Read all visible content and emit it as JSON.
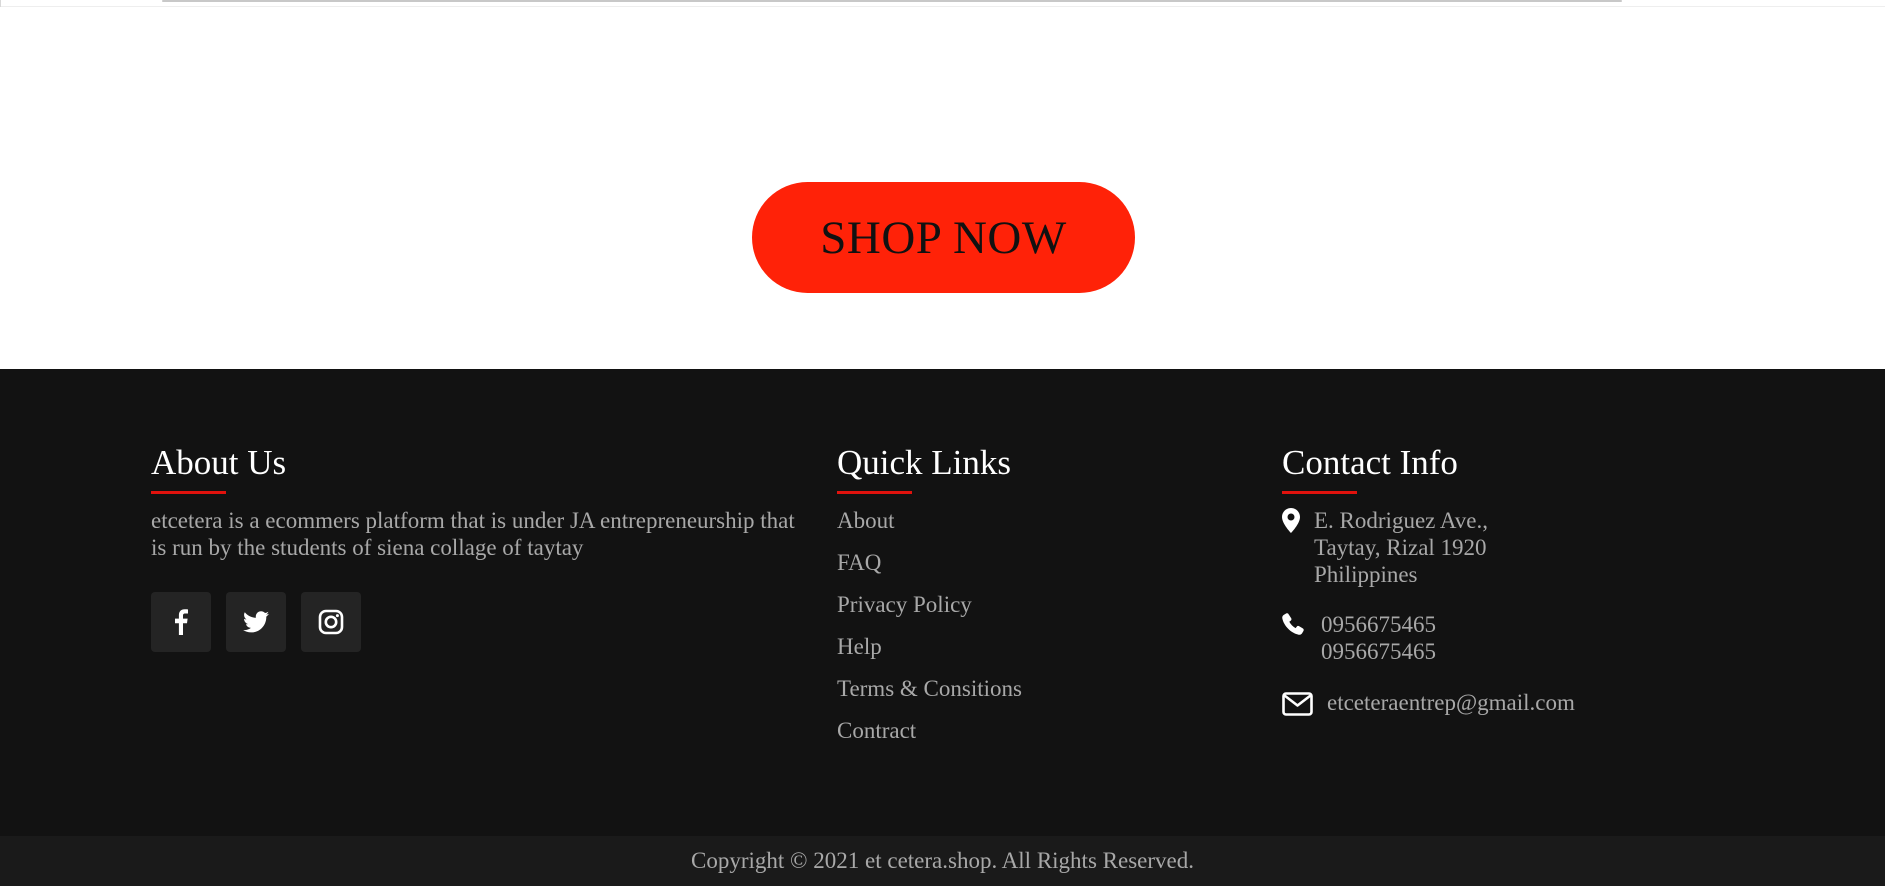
{
  "colors": {
    "accent": "#ff2208",
    "underline": "#e1120d",
    "footer_bg": "#121212",
    "copyright_bg": "#1a1a1a",
    "text_muted": "#a8a8a8",
    "heading": "#ffffff",
    "social_bg": "#242424"
  },
  "hero": {
    "shop_now_label": "SHOP NOW"
  },
  "footer": {
    "about": {
      "heading": "About Us",
      "text": "etcetera is a ecommers platform that is under JA entrepreneurship that is run by the students of siena collage of taytay",
      "social": [
        {
          "name": "facebook",
          "icon": "facebook-icon"
        },
        {
          "name": "twitter",
          "icon": "twitter-icon"
        },
        {
          "name": "instagram",
          "icon": "instagram-icon"
        }
      ]
    },
    "quick_links": {
      "heading": "Quick Links",
      "items": [
        "About",
        "FAQ",
        "Privacy Policy",
        "Help",
        "Terms & Consitions",
        "Contract"
      ]
    },
    "contact": {
      "heading": "Contact Info",
      "address_icon": "map-pin-icon",
      "address": [
        "E. Rodriguez Ave.,",
        "Taytay, Rizal 1920",
        "Philippines"
      ],
      "phone_icon": "phone-icon",
      "phones": [
        "0956675465",
        "0956675465"
      ],
      "email_icon": "envelope-icon",
      "email": "etceteraentrep@gmail.com"
    }
  },
  "copyright": "Copyright © 2021 et cetera.shop. All Rights Reserved."
}
